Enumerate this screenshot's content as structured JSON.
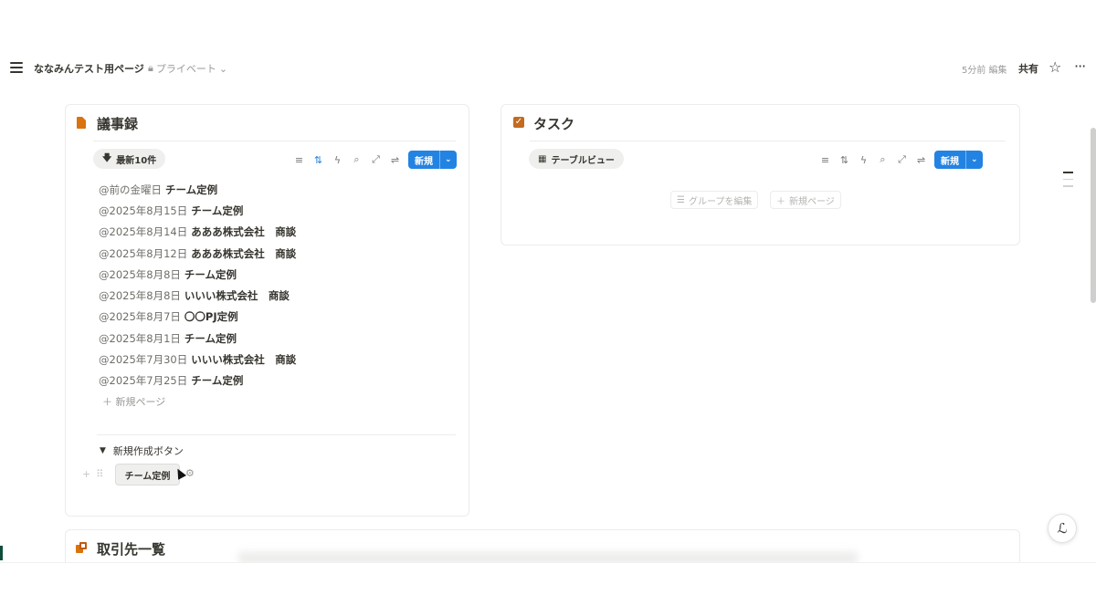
{
  "topbar": {
    "page_title": "ななみんテスト用ページ",
    "privacy": "プライベート",
    "edited": "5分前 編集",
    "share": "共有"
  },
  "minutes": {
    "title": "議事録",
    "sort_pill": "最新10件",
    "new_button": "新規",
    "items": [
      {
        "date": "@前の金曜日",
        "title": "チーム定例"
      },
      {
        "date": "@2025年8月15日",
        "title": "チーム定例"
      },
      {
        "date": "@2025年8月14日",
        "title": "あああ株式会社　商談"
      },
      {
        "date": "@2025年8月12日",
        "title": "あああ株式会社　商談"
      },
      {
        "date": "@2025年8月8日",
        "title": "チーム定例"
      },
      {
        "date": "@2025年8月8日",
        "title": "いいい株式会社　商談"
      },
      {
        "date": "@2025年8月7日",
        "title": "〇〇PJ定例"
      },
      {
        "date": "@2025年8月1日",
        "title": "チーム定例"
      },
      {
        "date": "@2025年7月30日",
        "title": "いいい株式会社　商談"
      },
      {
        "date": "@2025年7月25日",
        "title": "チーム定例"
      }
    ],
    "new_page": "新規ページ",
    "toggle_label": "新規作成ボタン",
    "template_button": "チーム定例"
  },
  "tasks": {
    "title": "タスク",
    "view_pill": "テーブルビュー",
    "new_button": "新規",
    "edit_group": "グループを編集",
    "new_page": "新規ページ"
  },
  "clients": {
    "title": "取引先一覧"
  },
  "colors": {
    "accent": "#2383e2",
    "orange": "#d9730d"
  }
}
